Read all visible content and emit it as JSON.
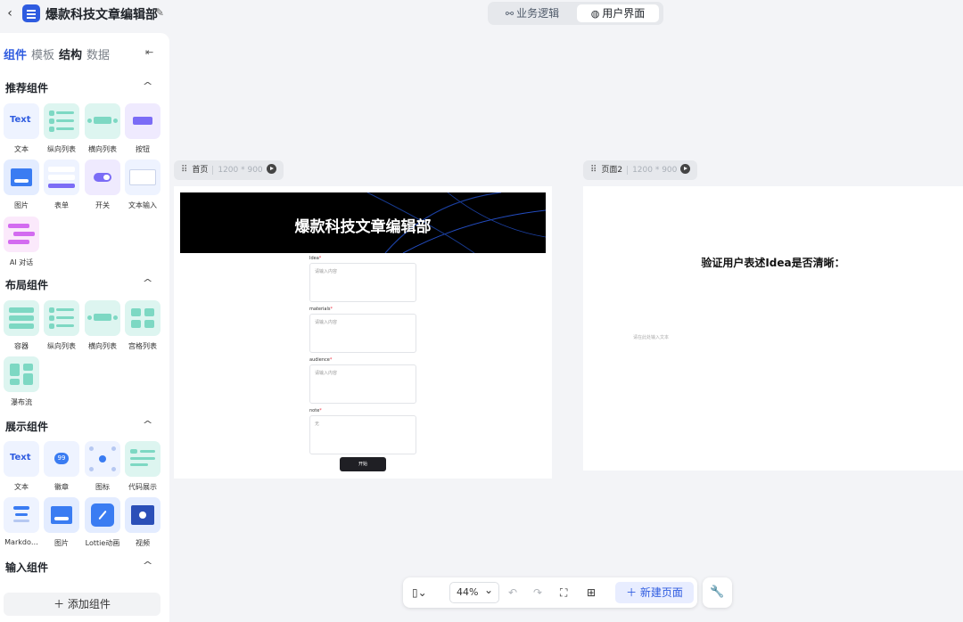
{
  "header": {
    "back_icon": "chevron-left-icon",
    "app_title": "爆款科技文章编辑部",
    "edit_icon": "edit-icon",
    "mode_tabs": [
      {
        "label": "业务逻辑",
        "icon": "flow-icon"
      },
      {
        "label": "用户界面",
        "icon": "palette-icon",
        "active": true
      }
    ]
  },
  "sidebar": {
    "tabs": [
      "组件",
      "模板",
      "结构",
      "数据"
    ],
    "active_tab": "组件",
    "sections": [
      {
        "title": "推荐组件",
        "items": [
          "文本",
          "纵向列表",
          "横向列表",
          "按钮",
          "图片",
          "表单",
          "开关",
          "文本输入",
          "AI 对话"
        ]
      },
      {
        "title": "布局组件",
        "items": [
          "容器",
          "纵向列表",
          "横向列表",
          "宫格列表",
          "瀑布流"
        ]
      },
      {
        "title": "展示组件",
        "items": [
          "文本",
          "徽章",
          "图标",
          "代码展示",
          "Markdo…",
          "图片",
          "Lottie动画",
          "视频"
        ]
      },
      {
        "title": "输入组件",
        "items": []
      }
    ],
    "tile_text": "Text",
    "badge_number": "99",
    "add_button": "添加组件"
  },
  "canvas": {
    "pages": [
      {
        "name": "首页",
        "size": "1200 * 900",
        "banner_title": "爆款科技文章编辑部",
        "fields": [
          {
            "label": "Idea",
            "placeholder": "请输入内容"
          },
          {
            "label": "materials",
            "placeholder": "请输入内容"
          },
          {
            "label": "audience",
            "placeholder": "请输入内容"
          },
          {
            "label": "note",
            "placeholder": "无"
          }
        ],
        "submit_label": "开始"
      },
      {
        "name": "页面2",
        "size": "1200 * 900",
        "heading": "验证用户表述Idea是否清晰：",
        "hint": "请在此处输入文本"
      }
    ]
  },
  "toolbar": {
    "zoom": "44%",
    "new_page": "新建页面"
  },
  "colors": {
    "accent": "#2f5ce0",
    "canvas_bg": "#f3f4f7",
    "banner_bg": "#000000"
  }
}
